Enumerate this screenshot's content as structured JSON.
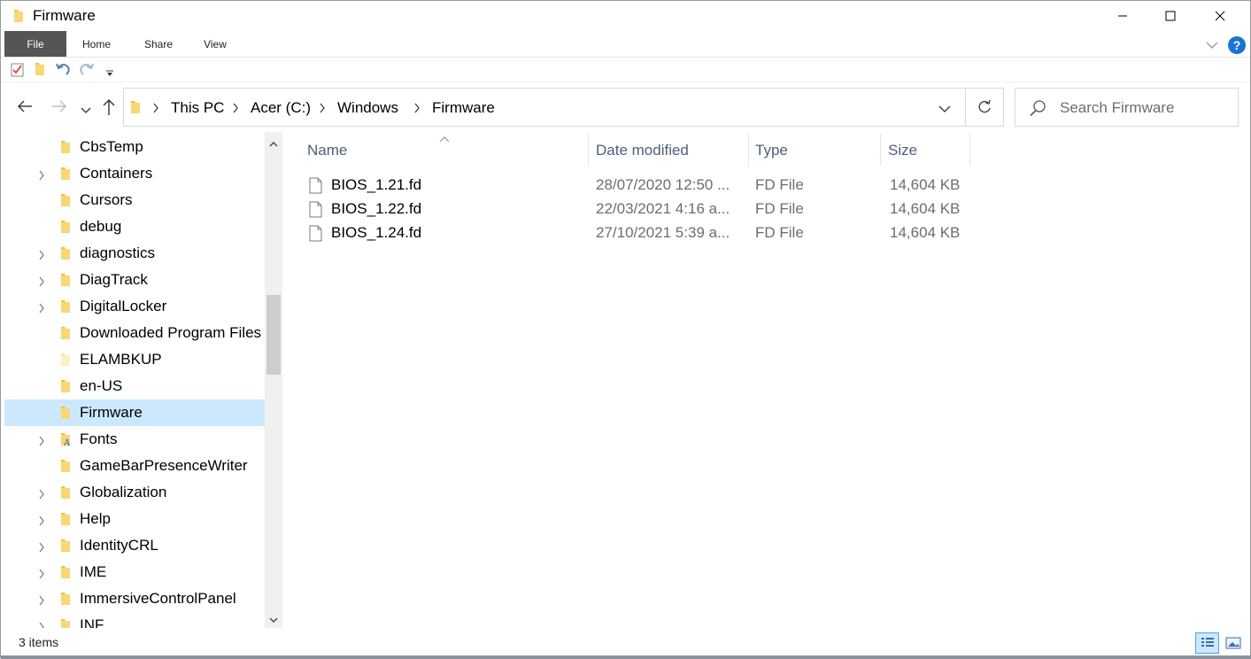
{
  "window": {
    "title": "Firmware"
  },
  "ribbon": {
    "tabs": [
      "File",
      "Home",
      "Share",
      "View"
    ]
  },
  "help": {
    "label": "?"
  },
  "address": {
    "crumbs": [
      "This PC",
      "Acer (C:)",
      "Windows",
      "Firmware"
    ]
  },
  "search": {
    "placeholder": "Search Firmware"
  },
  "nav": {
    "items": [
      {
        "label": "CbsTemp",
        "expandable": false,
        "selected": false,
        "icon": "folder-icon"
      },
      {
        "label": "Containers",
        "expandable": true,
        "selected": false,
        "icon": "folder-icon"
      },
      {
        "label": "Cursors",
        "expandable": false,
        "selected": false,
        "icon": "folder-icon"
      },
      {
        "label": "debug",
        "expandable": false,
        "selected": false,
        "icon": "folder-icon"
      },
      {
        "label": "diagnostics",
        "expandable": true,
        "selected": false,
        "icon": "folder-icon"
      },
      {
        "label": "DiagTrack",
        "expandable": true,
        "selected": false,
        "icon": "folder-icon"
      },
      {
        "label": "DigitalLocker",
        "expandable": true,
        "selected": false,
        "icon": "folder-icon"
      },
      {
        "label": "Downloaded Program Files",
        "expandable": false,
        "selected": false,
        "icon": "folder-icon"
      },
      {
        "label": "ELAMBKUP",
        "expandable": false,
        "selected": false,
        "icon": "folder-hidden-icon"
      },
      {
        "label": "en-US",
        "expandable": false,
        "selected": false,
        "icon": "folder-icon"
      },
      {
        "label": "Firmware",
        "expandable": false,
        "selected": true,
        "icon": "folder-icon"
      },
      {
        "label": "Fonts",
        "expandable": true,
        "selected": false,
        "icon": "fonts-folder-icon"
      },
      {
        "label": "GameBarPresenceWriter",
        "expandable": false,
        "selected": false,
        "icon": "folder-icon"
      },
      {
        "label": "Globalization",
        "expandable": true,
        "selected": false,
        "icon": "folder-icon"
      },
      {
        "label": "Help",
        "expandable": true,
        "selected": false,
        "icon": "folder-icon"
      },
      {
        "label": "IdentityCRL",
        "expandable": true,
        "selected": false,
        "icon": "folder-icon"
      },
      {
        "label": "IME",
        "expandable": true,
        "selected": false,
        "icon": "folder-icon"
      },
      {
        "label": "ImmersiveControlPanel",
        "expandable": true,
        "selected": false,
        "icon": "folder-icon"
      },
      {
        "label": "INF",
        "expandable": true,
        "selected": false,
        "icon": "folder-icon"
      }
    ]
  },
  "list": {
    "columns": [
      "Name",
      "Date modified",
      "Type",
      "Size"
    ],
    "rows": [
      {
        "name": "BIOS_1.21.fd",
        "date": "28/07/2020 12:50 ...",
        "type": "FD File",
        "size": "14,604 KB"
      },
      {
        "name": "BIOS_1.22.fd",
        "date": "22/03/2021 4:16 a...",
        "type": "FD File",
        "size": "14,604 KB"
      },
      {
        "name": "BIOS_1.24.fd",
        "date": "27/10/2021 5:39 a...",
        "type": "FD File",
        "size": "14,604 KB"
      }
    ]
  },
  "status": {
    "item_count": "3 items"
  },
  "colors": {
    "selection": "#cce8ff",
    "file_tab": "#555555",
    "folder": "#f3c13a",
    "header_text": "#4c607a"
  }
}
